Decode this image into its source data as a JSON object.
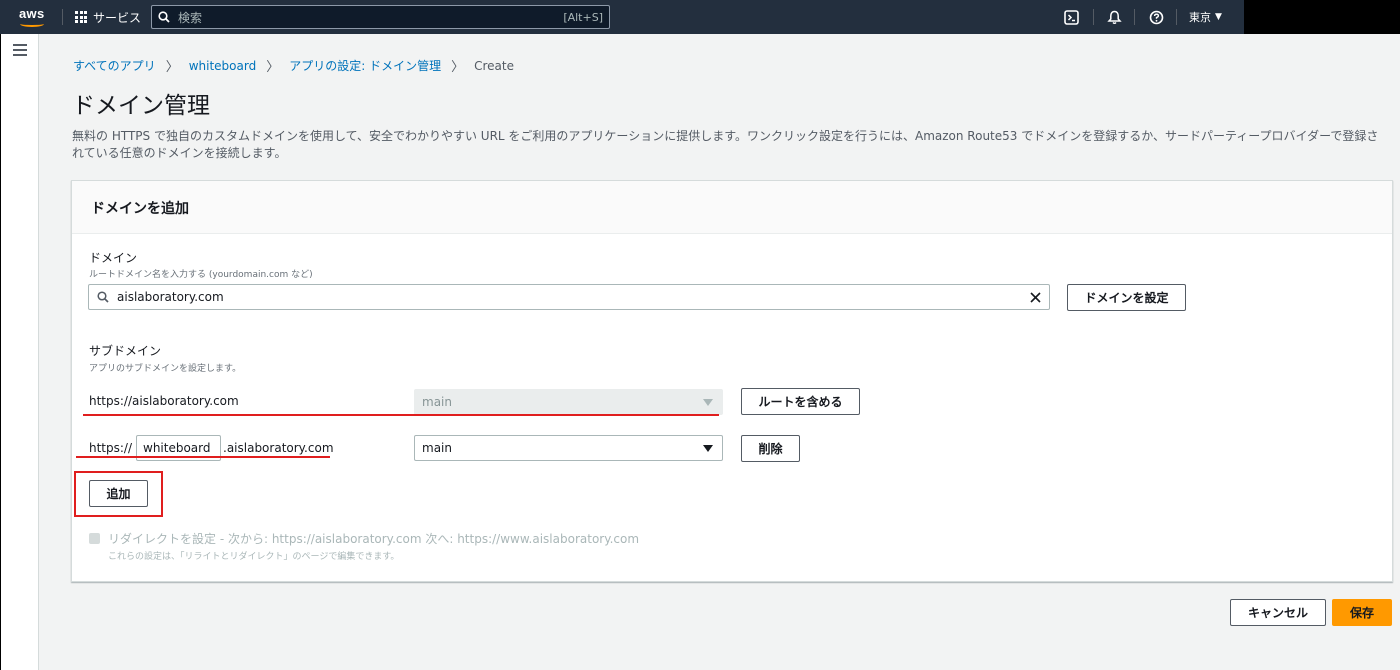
{
  "topnav": {
    "logo_text": "aws",
    "services_label": "サービス",
    "search_placeholder": "検索",
    "search_shortcut": "[Alt+S]",
    "region_label": "東京",
    "icons": [
      "cloudshell-icon",
      "bell-icon",
      "help-icon"
    ]
  },
  "breadcrumb": {
    "items": [
      "すべてのアプリ",
      "whiteboard",
      "アプリの設定: ドメイン管理"
    ],
    "current": "Create"
  },
  "page": {
    "title": "ドメイン管理",
    "description": "無料の HTTPS で独自のカスタムドメインを使用して、安全でわかりやすい URL をご利用のアプリケーションに提供します。ワンクリック設定を行うには、Amazon Route53 でドメインを登録するか、サードパーティープロバイダーで登録されている任意のドメインを接続します。"
  },
  "panel": {
    "title": "ドメインを追加",
    "domain": {
      "label": "ドメイン",
      "description": "ルートドメイン名を入力する (yourdomain.com など)",
      "value": "aislaboratory.com",
      "configure_button": "ドメインを設定"
    },
    "subdomain": {
      "label": "サブドメイン",
      "description": "アプリのサブドメインを設定します。",
      "rows": [
        {
          "url_text": "https://aislaboratory.com",
          "branch": "main",
          "button": "ルートを含める"
        },
        {
          "prefix": "https://",
          "value": "whiteboard",
          "suffix": ".aislaboratory.com",
          "branch": "main",
          "button": "削除"
        }
      ],
      "add_button": "追加"
    },
    "redirect": {
      "label": "リダイレクトを設定 - 次から: https://aislaboratory.com 次へ: https://www.aislaboratory.com",
      "description": "これらの設定は、「リライトとリダイレクト」のページで編集できます。"
    }
  },
  "footer": {
    "cancel": "キャンセル",
    "save": "保存"
  },
  "colors": {
    "nav_bg": "#232f3e",
    "link": "#0073bb",
    "primary": "#ff9900",
    "annotation_red": "#e01e1e"
  }
}
